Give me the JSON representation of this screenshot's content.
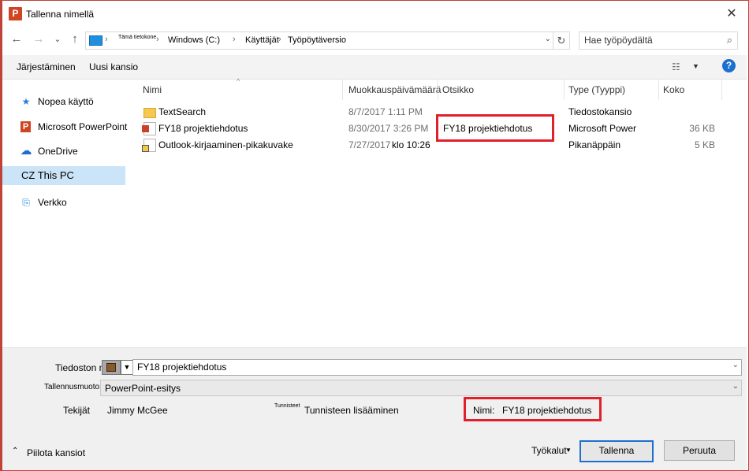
{
  "window": {
    "title": "Tallenna nimellä",
    "app_icon_letter": "P"
  },
  "navigation": {
    "back": "←",
    "forward": "→",
    "recent": "⌄",
    "up": "↑",
    "breadcrumb": [
      {
        "label": "Tämä tietokone"
      },
      {
        "label": "Windows (C:)"
      },
      {
        "label": "Käyttäjät"
      },
      {
        "label": "Työpöytäversio"
      }
    ],
    "search_placeholder": "Hae työpöydältä"
  },
  "commands": {
    "organize": "Järjestäminen",
    "new_folder": "Uusi kansio"
  },
  "sidebar": {
    "items": [
      {
        "label": "Nopea käyttö",
        "icon": "star-icon"
      },
      {
        "label": "Microsoft PowerPoint",
        "icon": "powerpoint-icon"
      },
      {
        "label": "OneDrive",
        "icon": "cloud-icon"
      },
      {
        "label": "CZ This PC",
        "icon": "",
        "selected": true
      },
      {
        "label": "Verkko",
        "icon": "network-icon"
      }
    ]
  },
  "columns": {
    "name": "Nimi",
    "modified": "Muokkauspäivämäärä",
    "title": "Otsikko",
    "type": "Type (Tyyppi)",
    "size": "Koko"
  },
  "files": [
    {
      "name": "TextSearch",
      "modified": "8/7/2017 1:11 PM",
      "title": "",
      "type": "Tiedostokansio",
      "size": "",
      "icon": "folder-icon"
    },
    {
      "name": "FY18 projektiehdotus",
      "modified": "8/30/2017 3:26 PM",
      "title": "FY18 projektiehdotus",
      "type": "Microsoft Power",
      "size": "36 KB",
      "icon": "pptx-file-icon"
    },
    {
      "name": "Outlook-kirjaaminen-pikakuvake",
      "modified": "7/27/2017",
      "modified_time": "klo 10:26",
      "title": "",
      "type": "Pikanäppäin",
      "size": "5 KB",
      "icon": "shortcut-icon"
    }
  ],
  "form": {
    "filename_label": "Tiedoston nimi:",
    "filename_value": "FY18 projektiehdotus",
    "filetype_label": "Tallennusmuoto:",
    "filetype_value": "PowerPoint-esitys",
    "authors_label": "Tekijät",
    "authors_value": "Jimmy McGee",
    "tags_label": "Tunnisteet",
    "tags_value": "Tunnisteen lisääminen",
    "title_label": "Nimi:",
    "title_value": "FY18 projektiehdotus"
  },
  "footer": {
    "hide_folders": "Piilota kansiot",
    "tools": "Työkalut",
    "save": "Tallenna",
    "cancel": "Peruuta"
  },
  "colors": {
    "accent": "#1f6fd1",
    "highlight": "#e0202a",
    "frame": "#c0433a",
    "selected": "#cce4f7"
  }
}
